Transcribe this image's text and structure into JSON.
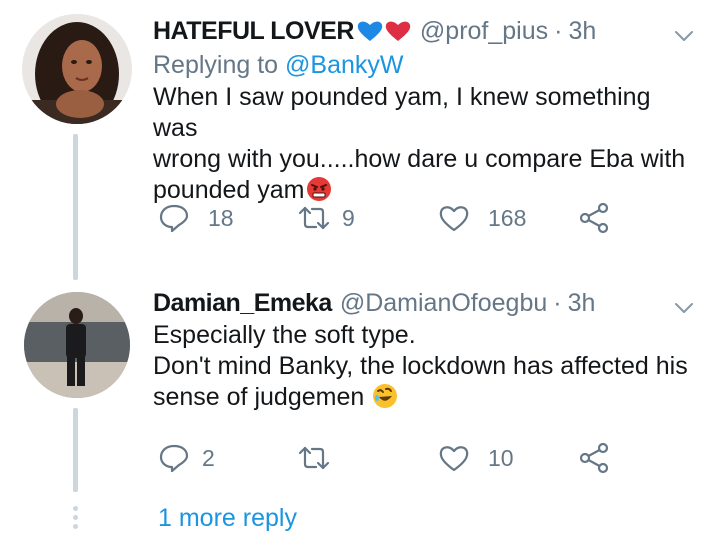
{
  "tweets": [
    {
      "display_name": "HATEFUL LOVER",
      "name_emojis": [
        "blue-heart",
        "red-heart"
      ],
      "handle": "@prof_pius",
      "separator": "·",
      "time": "3h",
      "replying_prefix": "Replying to",
      "replying_to": "@BankyW",
      "text_lines": [
        "When I saw pounded yam, I knew something was",
        "wrong with you.....how dare u compare Eba with",
        "pounded yam"
      ],
      "text_end_emoji": "angry-face",
      "replies": "18",
      "retweets": "9",
      "likes": "168"
    },
    {
      "display_name": "Damian_Emeka",
      "handle": "@DamianOfoegbu",
      "separator": "·",
      "time": "3h",
      "text_lines": [
        "Especially the soft type.",
        "Don't mind Banky, the lockdown has affected his",
        "sense of judgemen"
      ],
      "text_end_emoji": "rolling-laughing-face",
      "replies": "2",
      "retweets": "",
      "likes": "10"
    }
  ],
  "more_replies": "1 more reply",
  "colors": {
    "link": "#1b95e0",
    "secondary": "#657786",
    "thread_line": "#ccd6dd",
    "text": "#14171a"
  }
}
